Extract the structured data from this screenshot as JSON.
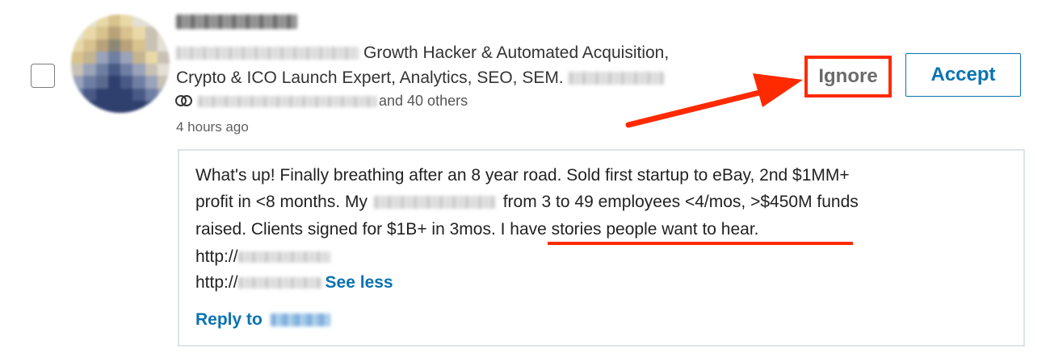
{
  "invitation": {
    "headline_line1": "Growth Hacker & Automated Acquisition,",
    "headline_line2": "Crypto & ICO Launch Expert, Analytics, SEO, SEM.",
    "mutual_connections": "and 40 others",
    "timestamp": "4 hours ago",
    "buttons": {
      "ignore_label": "Ignore",
      "accept_label": "Accept"
    }
  },
  "message": {
    "line1": "What's up! Finally breathing after an 8 year road. Sold first startup to eBay, 2nd $1MM+",
    "line2_start": "profit in <8 months. My",
    "line2_end": "from 3 to 49 employees <4/mos, >$450M funds",
    "line3_start": "raised. Clients signed for $1B+ in 3mos.",
    "line3_highlight": "I have stories people want to hear.",
    "link1_prefix": "http://",
    "link2_prefix": "http://",
    "see_less_label": "See less",
    "reply_label": "Reply to"
  },
  "annotation": {
    "arrow_color": "#ff2a00",
    "highlight_color": "#ff2a00"
  },
  "theme": {
    "accent": "#0a73b1"
  }
}
